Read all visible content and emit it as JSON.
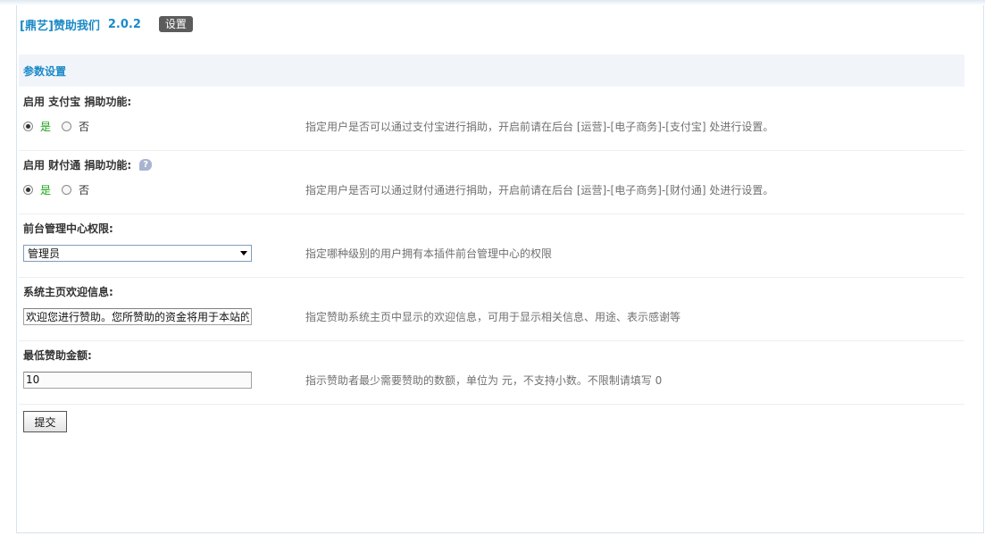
{
  "header": {
    "title": "[鼎艺]赞助我们",
    "version": "2.0.2",
    "settings_badge": "设置"
  },
  "section": {
    "title": "参数设置"
  },
  "settings": {
    "alipay": {
      "label": "启用 支付宝 捐助功能:",
      "yes": "是",
      "no": "否",
      "selected": "是",
      "hint": "指定用户是否可以通过支付宝进行捐助，开启前请在后台 [运营]-[电子商务]-[支付宝] 处进行设置。"
    },
    "tenpay": {
      "label": "启用 财付通 捐助功能:",
      "help_icon": "?",
      "yes": "是",
      "no": "否",
      "selected": "是",
      "hint": "指定用户是否可以通过财付通进行捐助，开启前请在后台 [运营]-[电子商务]-[财付通] 处进行设置。"
    },
    "admin_permission": {
      "label": "前台管理中心权限:",
      "selected": "管理员",
      "hint": "指定哪种级别的用户拥有本插件前台管理中心的权限"
    },
    "welcome": {
      "label": "系统主页欢迎信息:",
      "value": "欢迎您进行赞助。您所赞助的资金将用于本站的",
      "hint": "指定赞助系统主页中显示的欢迎信息，可用于显示相关信息、用途、表示感谢等"
    },
    "min_amount": {
      "label": "最低赞助金额:",
      "value": "10",
      "hint": "指示赞助者最少需要赞助的数额，单位为 元，不支持小数。不限制请填写 0"
    }
  },
  "submit_label": "提交"
}
